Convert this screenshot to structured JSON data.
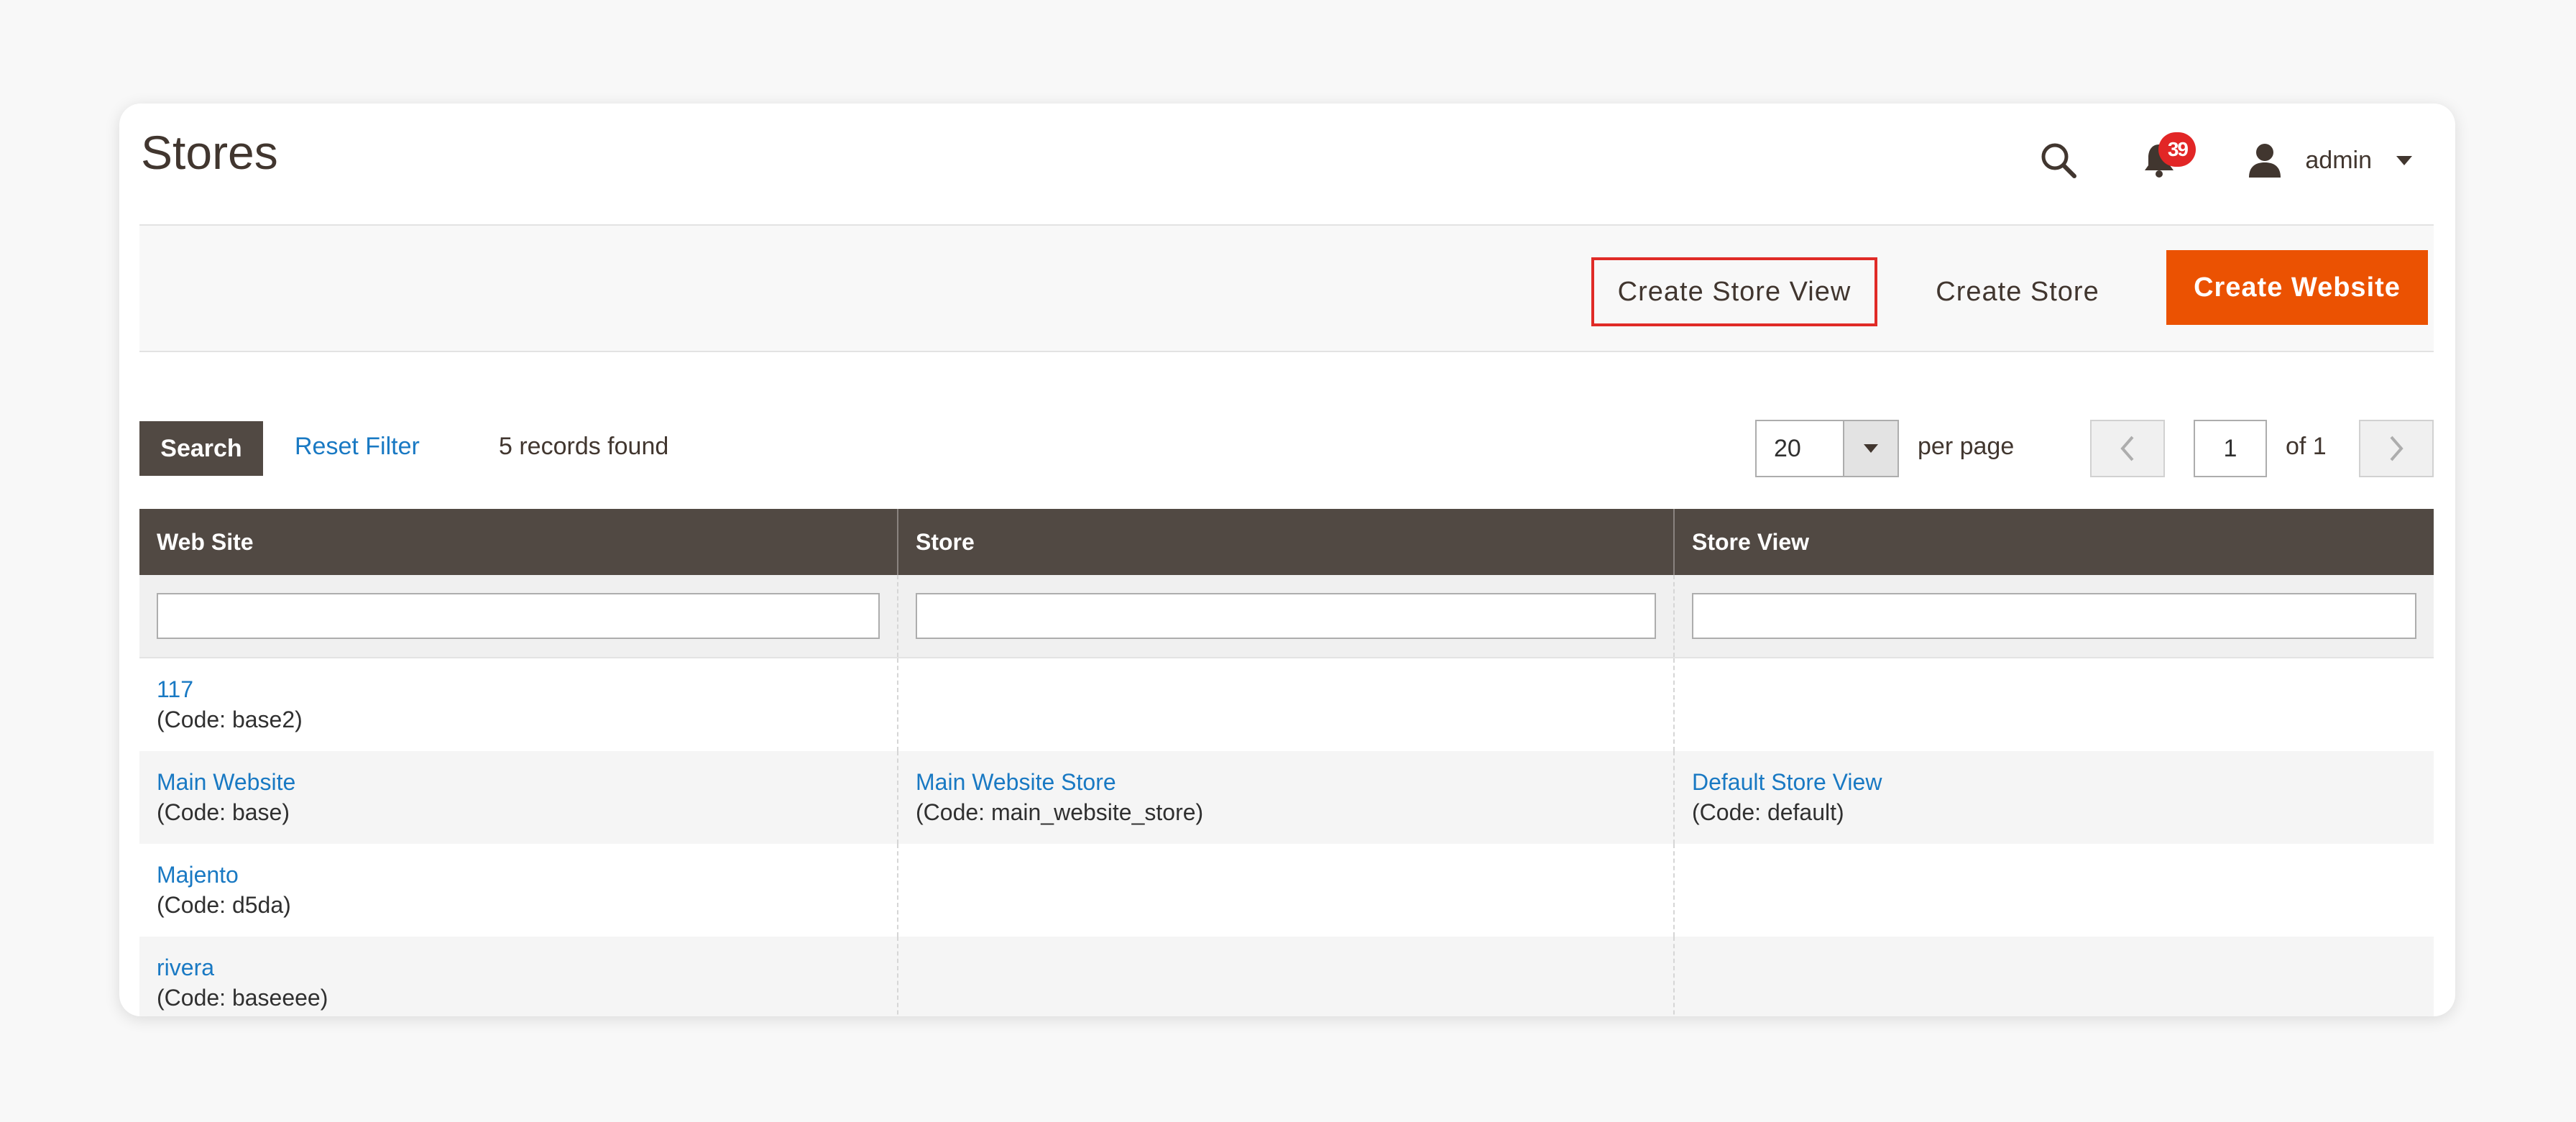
{
  "page": {
    "title": "Stores"
  },
  "header": {
    "notifications_count": "39",
    "user_name": "admin"
  },
  "actions": {
    "create_store_view": "Create Store View",
    "create_store": "Create Store",
    "create_website": "Create Website"
  },
  "toolbar": {
    "search_label": "Search",
    "reset_label": "Reset Filter",
    "records_text": "5 records found",
    "per_page_value": "20",
    "per_page_label": "per page",
    "current_page": "1",
    "of_pages": "of 1"
  },
  "grid": {
    "columns": [
      "Web Site",
      "Store",
      "Store View"
    ],
    "rows": [
      {
        "website": "117",
        "website_code": "(Code: base2)",
        "store": "",
        "store_code": "",
        "view": "",
        "view_code": ""
      },
      {
        "website": "Main Website",
        "website_code": "(Code: base)",
        "store": "Main Website Store",
        "store_code": "(Code: main_website_store)",
        "view": "Default Store View",
        "view_code": "(Code: default)"
      },
      {
        "website": "Majento",
        "website_code": "(Code: d5da)",
        "store": "",
        "store_code": "",
        "view": "",
        "view_code": ""
      },
      {
        "website": "rivera",
        "website_code": "(Code: baseeee)",
        "store": "",
        "store_code": "",
        "view": "",
        "view_code": ""
      }
    ]
  },
  "colors": {
    "accent": "#eb5202",
    "header_bg": "#514943",
    "link": "#1979c3",
    "highlight_border": "#e02b27",
    "badge": "#e22626"
  },
  "icons": {
    "search": "search-icon",
    "notifications": "bell-icon",
    "user": "user-icon",
    "dropdown": "caret-down-icon",
    "prev": "chevron-left-icon",
    "next": "chevron-right-icon"
  }
}
